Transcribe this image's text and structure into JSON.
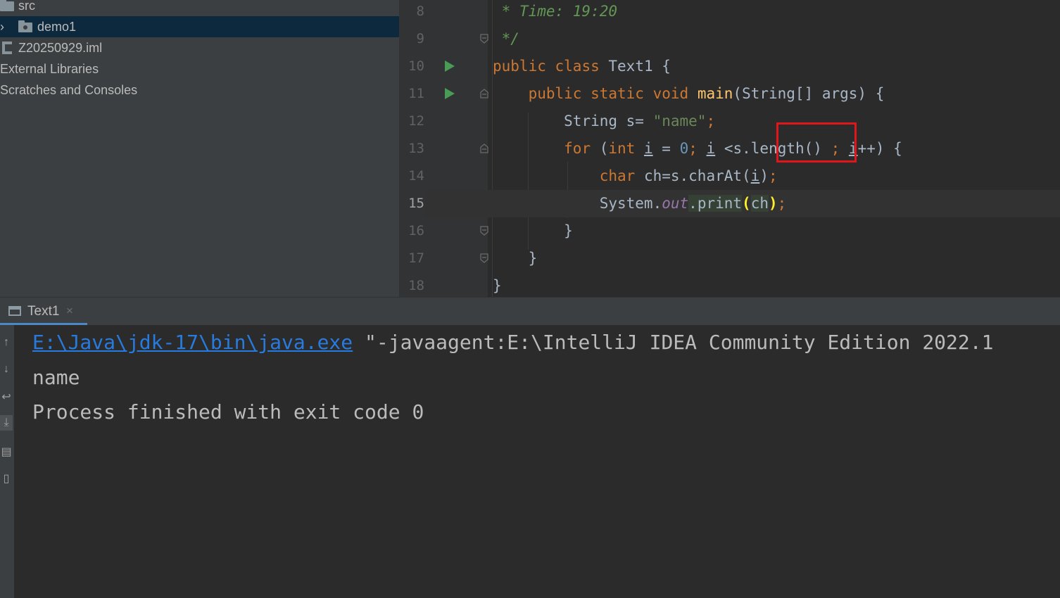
{
  "project_tree": {
    "items": [
      {
        "label": "src"
      },
      {
        "label": "demo1"
      },
      {
        "label": "Z20250929.iml"
      },
      {
        "label": "External Libraries"
      },
      {
        "label": "Scratches and Consoles"
      }
    ]
  },
  "editor": {
    "line_numbers": [
      "8",
      "9",
      "10",
      "11",
      "12",
      "13",
      "14",
      "15",
      "16",
      "17",
      "18"
    ],
    "current_line": "15",
    "lines": {
      "l8": {
        "comment": " * Time: 19:20"
      },
      "l9": {
        "comment": " */"
      },
      "l10": {
        "kw1": "public",
        "kw2": "class",
        "name": "Text1",
        "brace": "{"
      },
      "l11": {
        "kw1": "public",
        "kw2": "static",
        "kw3": "void",
        "fn": "main",
        "rest": "(String[] args) {"
      },
      "l12": {
        "pre": "String s= ",
        "str": "\"name\"",
        "semi": ";"
      },
      "l13": {
        "kw": "for",
        "p1": " (",
        "kw2": "int",
        "sp": " ",
        "v1": "i",
        "eq": " = ",
        "num": "0",
        "semi1": ";",
        "sp2": " ",
        "v2": "i",
        "lt": " <s.",
        "method": "length()",
        "sp3": " ",
        "semi2": ";",
        "sp4": " ",
        "v3": "i",
        "inc": "++) {"
      },
      "l14": {
        "kw": "char",
        "pre": " ch=s.charAt(",
        "v": "i",
        "post": ")",
        "semi": ";"
      },
      "l15": {
        "cls": "System.",
        "field": "out",
        "dot": ".print",
        "lp": "(",
        "arg": "ch",
        "rp": ")",
        "semi": ";"
      },
      "l16": {
        "text": "}"
      },
      "l17": {
        "text": "}"
      },
      "l18": {
        "text": "}"
      }
    },
    "colors": {
      "keyword": "#cc7832",
      "comment": "#629755",
      "string": "#6a8759",
      "number": "#6897bb",
      "highlight_box": "#e0161a"
    }
  },
  "run_panel": {
    "tab_label": "Text1",
    "close_glyph": "×",
    "console": {
      "exe_link": "E:\\Java\\jdk-17\\bin\\java.exe",
      "cmd_rest": " \"-javaagent:E:\\IntelliJ IDEA Community Edition 2022.1",
      "output": "name",
      "exit_message": "Process finished with exit code 0"
    },
    "toolbar_icons": [
      "arrow-up-icon",
      "arrow-down-icon",
      "soft-wrap-icon",
      "scroll-to-end-icon",
      "print-icon",
      "trash-icon"
    ]
  }
}
